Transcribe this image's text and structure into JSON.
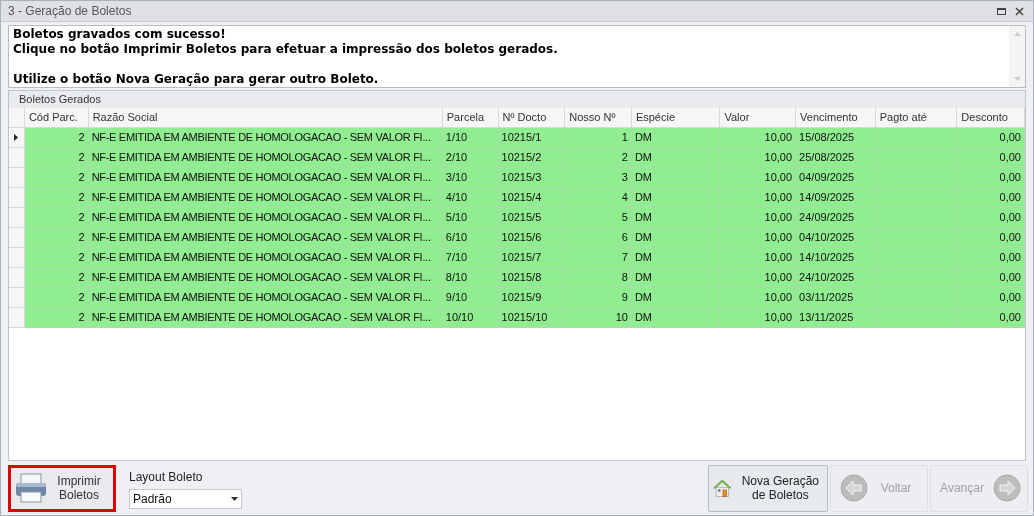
{
  "window": {
    "title": "3 - Geração de Boletos"
  },
  "message": {
    "paragraphs": [
      [
        "Boletos gravados com sucesso!",
        "Clique no botão Imprimir Boletos para efetuar a impressão dos boletos gerados."
      ],
      [
        "Utilize o botão Nova Geração para gerar outro Boleto."
      ]
    ]
  },
  "group": {
    "title": "Boletos Gerados"
  },
  "table": {
    "columns": [
      "Cód Parc.",
      "Razão Social",
      "Parcela",
      "Nº Docto",
      "Nosso Nº",
      "Espécie",
      "Valor",
      "Vencimento",
      "Pagto até",
      "Desconto"
    ],
    "rows": [
      {
        "current": true,
        "cells": [
          "2",
          "NF-E EMITIDA EM AMBIENTE DE HOMOLOGACAO - SEM VALOR FI...",
          "1/10",
          "10215/1",
          "1",
          "DM",
          "10,00",
          "15/08/2025",
          "",
          "0,00"
        ]
      },
      {
        "current": false,
        "cells": [
          "2",
          "NF-E EMITIDA EM AMBIENTE DE HOMOLOGACAO - SEM VALOR FI...",
          "2/10",
          "10215/2",
          "2",
          "DM",
          "10,00",
          "25/08/2025",
          "",
          "0,00"
        ]
      },
      {
        "current": false,
        "cells": [
          "2",
          "NF-E EMITIDA EM AMBIENTE DE HOMOLOGACAO - SEM VALOR FI...",
          "3/10",
          "10215/3",
          "3",
          "DM",
          "10,00",
          "04/09/2025",
          "",
          "0,00"
        ]
      },
      {
        "current": false,
        "cells": [
          "2",
          "NF-E EMITIDA EM AMBIENTE DE HOMOLOGACAO - SEM VALOR FI...",
          "4/10",
          "10215/4",
          "4",
          "DM",
          "10,00",
          "14/09/2025",
          "",
          "0,00"
        ]
      },
      {
        "current": false,
        "cells": [
          "2",
          "NF-E EMITIDA EM AMBIENTE DE HOMOLOGACAO - SEM VALOR FI...",
          "5/10",
          "10215/5",
          "5",
          "DM",
          "10,00",
          "24/09/2025",
          "",
          "0,00"
        ]
      },
      {
        "current": false,
        "cells": [
          "2",
          "NF-E EMITIDA EM AMBIENTE DE HOMOLOGACAO - SEM VALOR FI...",
          "6/10",
          "10215/6",
          "6",
          "DM",
          "10,00",
          "04/10/2025",
          "",
          "0,00"
        ]
      },
      {
        "current": false,
        "cells": [
          "2",
          "NF-E EMITIDA EM AMBIENTE DE HOMOLOGACAO - SEM VALOR FI...",
          "7/10",
          "10215/7",
          "7",
          "DM",
          "10,00",
          "14/10/2025",
          "",
          "0,00"
        ]
      },
      {
        "current": false,
        "cells": [
          "2",
          "NF-E EMITIDA EM AMBIENTE DE HOMOLOGACAO - SEM VALOR FI...",
          "8/10",
          "10215/8",
          "8",
          "DM",
          "10,00",
          "24/10/2025",
          "",
          "0,00"
        ]
      },
      {
        "current": false,
        "cells": [
          "2",
          "NF-E EMITIDA EM AMBIENTE DE HOMOLOGACAO - SEM VALOR FI...",
          "9/10",
          "10215/9",
          "9",
          "DM",
          "10,00",
          "03/11/2025",
          "",
          "0,00"
        ]
      },
      {
        "current": false,
        "cells": [
          "2",
          "NF-E EMITIDA EM AMBIENTE DE HOMOLOGACAO - SEM VALOR FI...",
          "10/10",
          "10215/10",
          "10",
          "DM",
          "10,00",
          "13/11/2025",
          "",
          "0,00"
        ]
      }
    ]
  },
  "print_button": {
    "label": "Imprimir Boletos",
    "highlighted": true
  },
  "layout": {
    "label": "Layout Boleto",
    "value": "Padrão"
  },
  "nav_buttons": [
    {
      "kind": "new",
      "label": "Nova Geração de Boletos",
      "disabled": false
    },
    {
      "kind": "back",
      "label": "Voltar",
      "disabled": true
    },
    {
      "kind": "forward",
      "label": "Avançar",
      "disabled": true
    }
  ]
}
